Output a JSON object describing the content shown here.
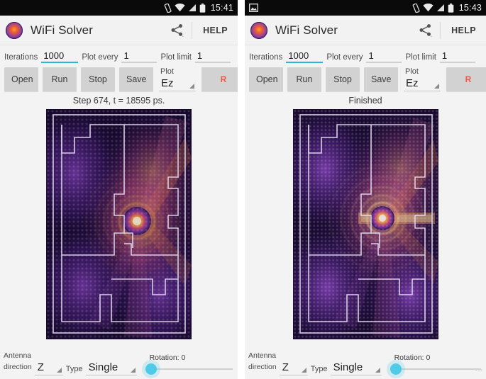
{
  "panels": [
    {
      "id": "left",
      "statusbar": {
        "left_icons": [],
        "right_icons": [
          "vibrate-icon",
          "wifi-icon",
          "signal-icon",
          "battery-icon"
        ],
        "time": "15:41"
      },
      "appbar": {
        "logo_icon": "wifi-solver-logo-icon",
        "title": "WiFi Solver",
        "share_icon": "share-icon",
        "help_label": "HELP"
      },
      "params": [
        {
          "label": "Iterations",
          "value": "1000",
          "focused": true,
          "name": "iterations"
        },
        {
          "label": "Plot every",
          "value": "1",
          "focused": false,
          "name": "plot-every"
        },
        {
          "label": "Plot limit",
          "value": "1",
          "focused": false,
          "name": "plot-limit"
        }
      ],
      "buttons": [
        {
          "label": "Open",
          "name": "open"
        },
        {
          "label": "Run",
          "name": "run"
        },
        {
          "label": "Stop",
          "name": "stop"
        },
        {
          "label": "Save",
          "name": "save"
        }
      ],
      "plot_spinner": {
        "label": "Plot",
        "value": "Ez"
      },
      "r_button": {
        "label": "R",
        "color": "#f2564a"
      },
      "status_text": "Step 674, t = 18595 ps.",
      "bottom": {
        "antenna_label_line1": "Antenna",
        "antenna_label_line2": "direction",
        "antenna_value": "Z",
        "type_label": "Type",
        "type_value": "Single",
        "rotation_label": "Rotation: 0",
        "rotation_value": 0
      },
      "watermark": ""
    },
    {
      "id": "right",
      "statusbar": {
        "left_icons": [
          "screenshot-image-icon"
        ],
        "right_icons": [
          "vibrate-icon",
          "wifi-icon",
          "signal-icon",
          "battery-icon"
        ],
        "time": "15:43"
      },
      "appbar": {
        "logo_icon": "wifi-solver-logo-icon",
        "title": "WiFi Solver",
        "share_icon": "share-icon",
        "help_label": "HELP"
      },
      "params": [
        {
          "label": "Iterations",
          "value": "1000",
          "focused": true,
          "name": "iterations"
        },
        {
          "label": "Plot every",
          "value": "1",
          "focused": false,
          "name": "plot-every"
        },
        {
          "label": "Plot limit",
          "value": "1",
          "focused": false,
          "name": "plot-limit"
        }
      ],
      "buttons": [
        {
          "label": "Open",
          "name": "open"
        },
        {
          "label": "Run",
          "name": "run"
        },
        {
          "label": "Stop",
          "name": "stop"
        },
        {
          "label": "Save",
          "name": "save"
        }
      ],
      "plot_spinner": {
        "label": "Plot",
        "value": "Ez"
      },
      "r_button": {
        "label": "R",
        "color": "#f2564a"
      },
      "status_text": "Finished",
      "bottom": {
        "antenna_label_line1": "Antenna",
        "antenna_label_line2": "direction",
        "antenna_value": "Z",
        "type_label": "Type",
        "type_value": "Single",
        "rotation_label": "Rotation: 0",
        "rotation_value": 0
      },
      "watermark": "▪▪▪"
    }
  ],
  "theme": {
    "accent": "#29b6d8",
    "slider_thumb": "#4ecbe8",
    "button_bg": "#d2d2d2",
    "r_color": "#f2564a",
    "appbar_bg": "#f2f2f2",
    "page_bg": "#f3f3f3",
    "statusbar_bg": "#0a0a0a"
  }
}
